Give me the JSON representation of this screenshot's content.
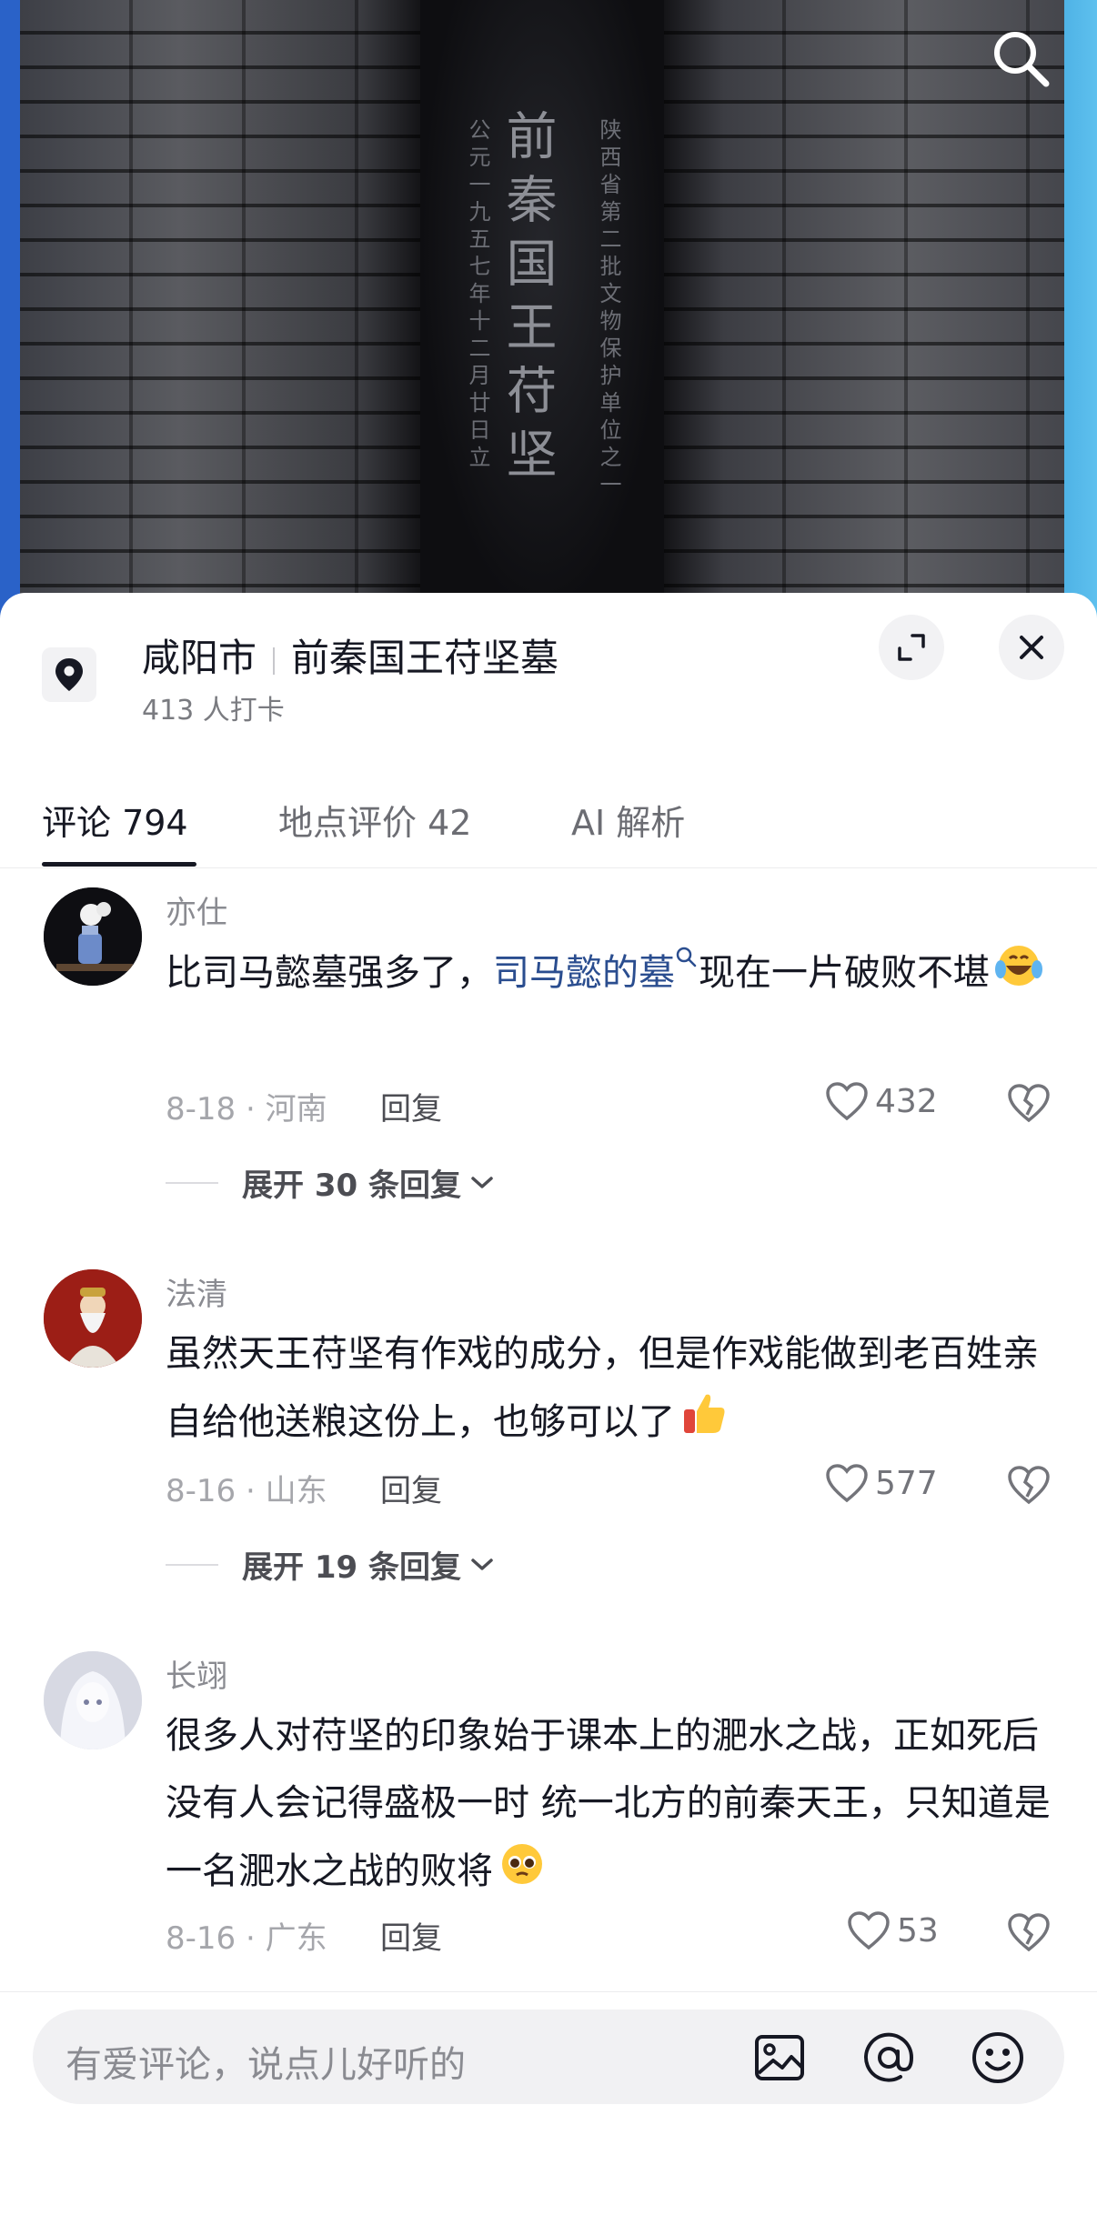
{
  "photo": {
    "stele_main_text": "前秦国王苻坚",
    "stele_right_text": "陕西省第二批文物保护单位之一",
    "stele_left_text": "公元一九五七年十二月廿日立"
  },
  "location": {
    "city": "咸阳市",
    "name": "前秦国王苻坚墓",
    "checkins": "413 人打卡"
  },
  "tabs": [
    {
      "label": "评论 794",
      "active": true
    },
    {
      "label": "地点评价 42",
      "active": false
    },
    {
      "label": "AI 解析",
      "active": false
    }
  ],
  "comments": [
    {
      "user": "亦仕",
      "text_before": "比司马懿墓强多了，",
      "link": "司马懿的墓",
      "text_after": "现在一片破败不堪",
      "emoji": "laughing-crying-emoji",
      "date_region": "8-18 · 河南",
      "reply_label": "回复",
      "likes": "432",
      "expand_label": "展开 30 条回复"
    },
    {
      "user": "法清",
      "text": "虽然天王苻坚有作戏的成分，但是作戏能做到老百姓亲自给他送粮这份上，也够可以了",
      "emoji": "thumbs-up-emoji",
      "date_region": "8-16 · 山东",
      "reply_label": "回复",
      "likes": "577",
      "expand_label": "展开 19 条回复"
    },
    {
      "user": "长翊",
      "text": "很多人对苻坚的印象始于课本上的淝水之战，正如死后没有人会记得盛极一时 统一北方的前秦天王，只知道是一名淝水之战的败将",
      "emoji": "pleading-face-emoji",
      "date_region": "8-16 · 广东",
      "reply_label": "回复",
      "likes": "53"
    }
  ],
  "input": {
    "placeholder": "有爱评论，说点儿好听的"
  },
  "colors": {
    "link": "#2a4d8f",
    "text": "#161823",
    "muted": "#a5a6ab"
  }
}
